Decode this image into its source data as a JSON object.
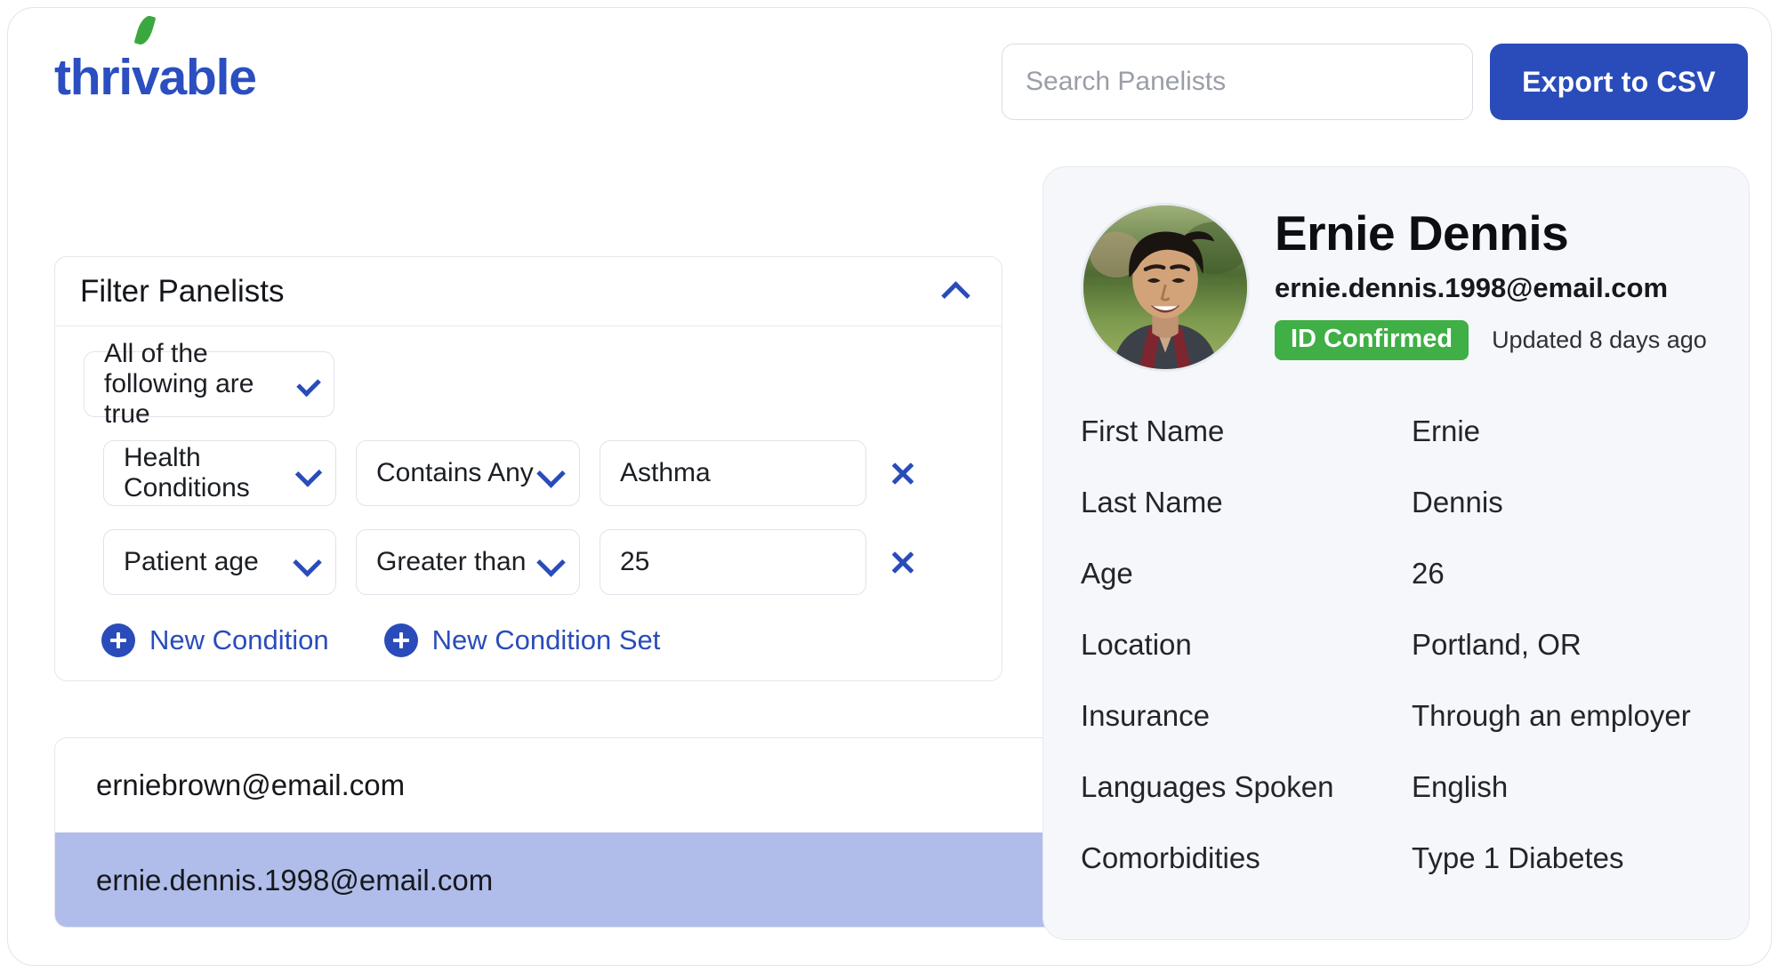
{
  "header": {
    "logo_text_pre": "thri",
    "logo_text_v": "v",
    "logo_text_post": "able",
    "search_placeholder": "Search Panelists",
    "search_value": "",
    "export_label": "Export to CSV"
  },
  "filter": {
    "title": "Filter Panelists",
    "collapse_icon": "chevron-up-icon",
    "match_select": "All of the following are true",
    "conditions": [
      {
        "field": "Health Conditions",
        "operator": "Contains Any",
        "value": "Asthma"
      },
      {
        "field": "Patient age",
        "operator": "Greater than",
        "value": "25"
      }
    ],
    "new_condition_label": "New Condition",
    "new_condition_set_label": "New Condition Set"
  },
  "results": {
    "rows": [
      {
        "email": "erniebrown@email.com",
        "selected": false
      },
      {
        "email": "ernie.dennis.1998@email.com",
        "selected": true
      }
    ]
  },
  "detail": {
    "name": "Ernie Dennis",
    "email": "ernie.dennis.1998@email.com",
    "badge": "ID Confirmed",
    "updated": "Updated 8 days ago",
    "fields": [
      {
        "label": "First Name",
        "value": "Ernie"
      },
      {
        "label": "Last Name",
        "value": "Dennis"
      },
      {
        "label": "Age",
        "value": "26"
      },
      {
        "label": "Location",
        "value": "Portland, OR"
      },
      {
        "label": "Insurance",
        "value": "Through an employer"
      },
      {
        "label": "Languages Spoken",
        "value": "English"
      },
      {
        "label": "Comorbidities",
        "value": "Type 1 Diabetes"
      }
    ]
  },
  "colors": {
    "brand_blue": "#2a4cba",
    "leaf_green": "#3aa83e",
    "badge_green": "#3faf46",
    "selected_row": "#b0bdea",
    "detail_card_bg": "#f5f7fb"
  }
}
